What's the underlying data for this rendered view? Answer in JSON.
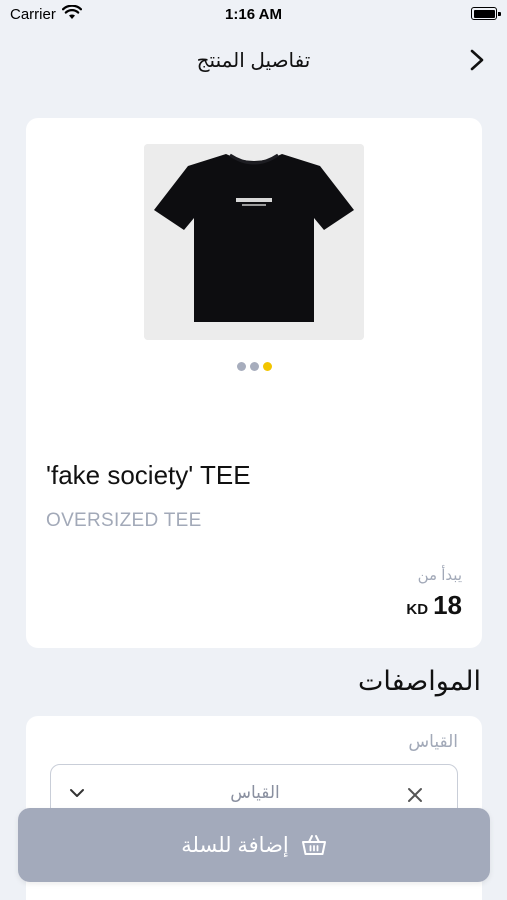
{
  "status_bar": {
    "carrier": "Carrier",
    "time": "1:16 AM"
  },
  "header": {
    "title": "تفاصيل المنتج",
    "back_icon": "chevron-right-icon"
  },
  "product": {
    "name": "'fake society' TEE",
    "subtitle": "OVERSIZED TEE",
    "starts_from_label": "يبدأ من",
    "price_currency": "KD",
    "price_amount": "18",
    "image_count": 3,
    "active_image_index": 2
  },
  "specs": {
    "title": "المواصفات",
    "size_label": "القياس",
    "size_placeholder": "القياس"
  },
  "cart_button": {
    "label": "إضافة للسلة",
    "icon": "basket-icon"
  },
  "colors": {
    "background": "#eef1f6",
    "card": "#ffffff",
    "muted_text": "#a2a9b8",
    "active_dot": "#f2c500",
    "inactive_dot": "#a7adbd",
    "button": "#a3aabb"
  }
}
